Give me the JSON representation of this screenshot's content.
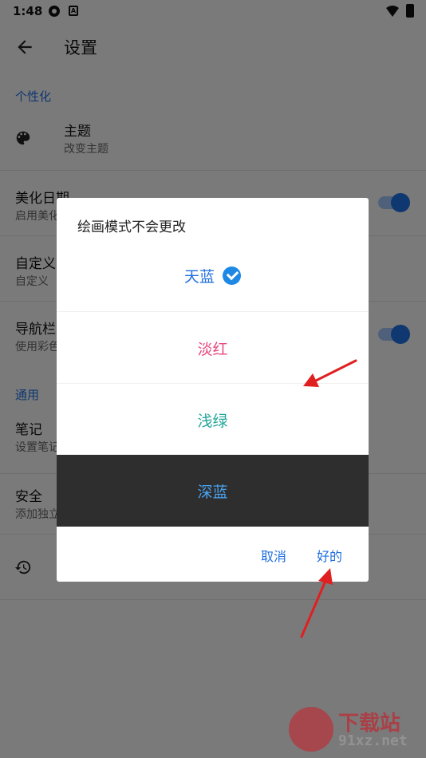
{
  "status_bar": {
    "time": "1:48"
  },
  "app_bar": {
    "title": "设置"
  },
  "sections": {
    "personalize": "个性化",
    "general": "通用"
  },
  "rows": {
    "theme": {
      "title": "主题",
      "subtitle": "改变主题"
    },
    "beautify_date": {
      "title": "美化日期",
      "subtitle": "启用美化"
    },
    "custom": {
      "title": "自定义",
      "subtitle": "自定义"
    },
    "nav_bar": {
      "title": "导航栏",
      "subtitle": "使用彩色"
    },
    "notes": {
      "title": "笔记",
      "subtitle": "设置笔记"
    },
    "security": {
      "title": "安全",
      "subtitle": "添加独立"
    }
  },
  "dialog": {
    "title": "绘画模式不会更改",
    "options": [
      {
        "label": "天蓝",
        "color": "#1e6ee0",
        "selected": true
      },
      {
        "label": "淡红",
        "color": "#e84a7f",
        "selected": false
      },
      {
        "label": "浅绿",
        "color": "#26a69a",
        "selected": false
      },
      {
        "label": "深蓝",
        "color": "#4aa3f0",
        "selected": false,
        "background": "#2e2e2e"
      }
    ],
    "cancel": "取消",
    "ok": "好的"
  },
  "watermark": {
    "cn": "下载站",
    "en": "91xz.net"
  },
  "colors": {
    "accent": "#1e6ee0",
    "arrow": "#e02020"
  }
}
